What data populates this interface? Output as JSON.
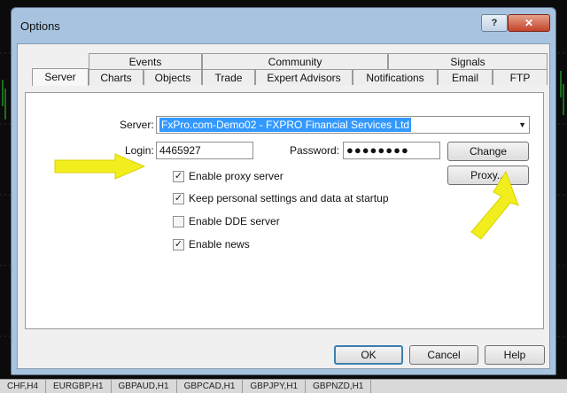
{
  "window": {
    "title": "Options",
    "help_label": "?",
    "close_label": "✕"
  },
  "tabs": {
    "top_row": [
      "Events",
      "Community",
      "Signals"
    ],
    "bottom_row": [
      "Server",
      "Charts",
      "Objects",
      "Trade",
      "Expert Advisors",
      "Notifications",
      "Email",
      "FTP"
    ],
    "active": "Server"
  },
  "form": {
    "server_label": "Server:",
    "server_value": "FxPro.com-Demo02 - FXPRO Financial Services Ltd",
    "login_label": "Login:",
    "login_value": "4465927",
    "password_label": "Password:",
    "password_value": "●●●●●●●●",
    "change_label": "Change",
    "proxy_label": "Proxy...",
    "checkboxes": [
      {
        "label": "Enable proxy server",
        "checked": true
      },
      {
        "label": "Keep personal settings and data at startup",
        "checked": true
      },
      {
        "label": "Enable DDE server",
        "checked": false
      },
      {
        "label": "Enable news",
        "checked": true
      }
    ]
  },
  "footer": {
    "ok_label": "OK",
    "cancel_label": "Cancel",
    "help_label": "Help"
  },
  "background_tabs": [
    "CHF,H4",
    "EURGBP,H1",
    "GBPAUD,H1",
    "GBPCAD,H1",
    "GBPJPY,H1",
    "GBPNZD,H1"
  ],
  "colors": {
    "arrow": "#f2ee1e",
    "selection": "#3399ff",
    "frame": "#a7c3df",
    "close": "#c4432a"
  }
}
